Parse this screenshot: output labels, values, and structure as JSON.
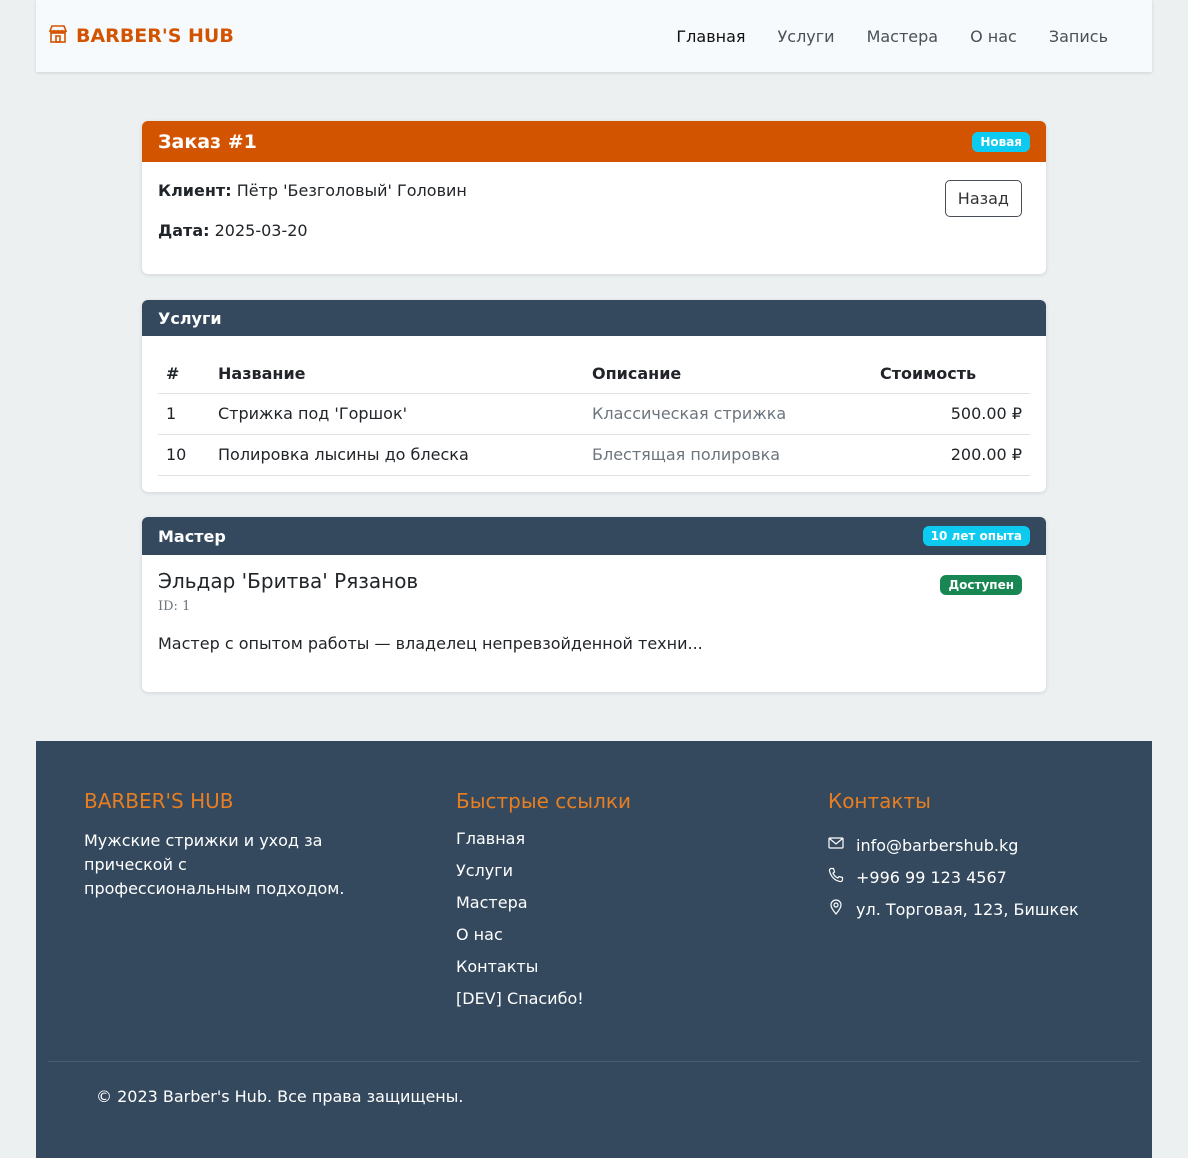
{
  "nav": {
    "brand": "BARBER'S HUB",
    "links": [
      "Главная",
      "Услуги",
      "Мастера",
      "О нас",
      "Запись"
    ]
  },
  "order": {
    "title": "Заказ #1",
    "status_badge": "Новая",
    "client_label": "Клиент:",
    "client_value": "Пётр 'Безголовый' Головин",
    "date_label": "Дата:",
    "date_value": "2025-03-20",
    "back_button": "Назад"
  },
  "services": {
    "title": "Услуги",
    "columns": [
      "#",
      "Название",
      "Описание",
      "Стоимость"
    ],
    "rows": [
      {
        "id": "1",
        "name": "Стрижка под 'Горшок'",
        "desc": "Классическая стрижка",
        "price": "500.00 ₽"
      },
      {
        "id": "10",
        "name": "Полировка лысины до блеска",
        "desc": "Блестящая полировка",
        "price": "200.00 ₽"
      }
    ]
  },
  "master": {
    "title": "Мастер",
    "experience_badge": "10 лет опыта",
    "name": "Эльдар 'Бритва' Рязанов",
    "id_text": "ID: 1",
    "available_badge": "Доступен",
    "description": "Мастер с опытом работы — владелец непревзойденной техни..."
  },
  "footer": {
    "brand_title": "BARBER'S HUB",
    "brand_text": "Мужские стрижки и уход за прической с профессиональным подходом.",
    "links_title": "Быстрые ссылки",
    "links": [
      "Главная",
      "Услуги",
      "Мастера",
      "О нас",
      "Контакты",
      "[DEV] Спасибо!"
    ],
    "contacts_title": "Контакты",
    "email": "info@barbershub.kg",
    "phone": "+996 99 123 4567",
    "address": "ул. Торговая, 123, Бишкек",
    "copyright": "© 2023 Barber's Hub. Все права защищены."
  },
  "colors": {
    "brand": "#d35400",
    "dark": "#34495e",
    "footer_heading": "#e67e22",
    "info_badge": "#0dcaf0",
    "success_badge": "#198754"
  }
}
